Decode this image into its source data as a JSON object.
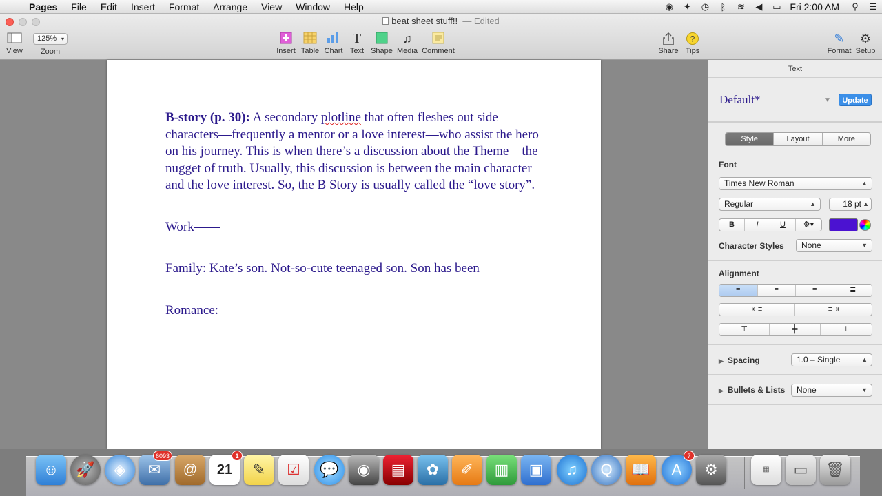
{
  "menubar": {
    "app_name": "Pages",
    "items": [
      "File",
      "Edit",
      "Insert",
      "Format",
      "Arrange",
      "View",
      "Window",
      "Help"
    ],
    "status_icons": [
      "record-icon",
      "dropbox-icon",
      "time-machine-icon",
      "bluetooth-icon",
      "wifi-icon",
      "volume-icon",
      "battery-icon"
    ],
    "clock": "Fri 2:00 AM"
  },
  "window": {
    "doc_name": "beat sheet stuff!!",
    "edited_label": "— Edited"
  },
  "toolbar": {
    "view_label": "View",
    "zoom_value": "125%",
    "zoom_label": "Zoom",
    "insert_label": "Insert",
    "table_label": "Table",
    "chart_label": "Chart",
    "text_label": "Text",
    "shape_label": "Shape",
    "media_label": "Media",
    "comment_label": "Comment",
    "share_label": "Share",
    "tips_label": "Tips",
    "format_label": "Format",
    "setup_label": "Setup"
  },
  "document": {
    "p1_bold": "B-story (p. 30):",
    "p1_text_a": " A secondary ",
    "p1_misspelled": "plotline",
    "p1_text_b": " that often fleshes out side characters—frequently a mentor or a love interest—who assist the hero on his journey. This is when there’s a discussion about the Theme – the nugget of truth. Usually, this discussion is between the main character and the love interest. So, the B Story is usually called the “love story”.",
    "p2": "Work——",
    "p3": "Family: Kate’s son. Not-so-cute teenaged son. Son has been",
    "p4": "Romance:"
  },
  "inspector": {
    "panel_title": "Text",
    "style_name": "Default*",
    "update_label": "Update",
    "tabs": [
      "Style",
      "Layout",
      "More"
    ],
    "font_label": "Font",
    "font_family": "Times New Roman",
    "font_typeface": "Regular",
    "font_size": "18 pt",
    "bold_label": "B",
    "italic_label": "I",
    "underline_label": "U",
    "text_color": "#4b12d1",
    "character_styles_label": "Character Styles",
    "character_styles_value": "None",
    "alignment_label": "Alignment",
    "spacing_label": "Spacing",
    "spacing_value": "1.0 – Single",
    "bullets_label": "Bullets & Lists",
    "bullets_value": "None"
  },
  "dock": {
    "mail_badge": "6093",
    "calendar_badge": "1",
    "calendar_date": "21",
    "appstore_badge": "7"
  },
  "colors": {
    "body_text": "#2c1a8c",
    "accent": "#3b8fe8"
  }
}
